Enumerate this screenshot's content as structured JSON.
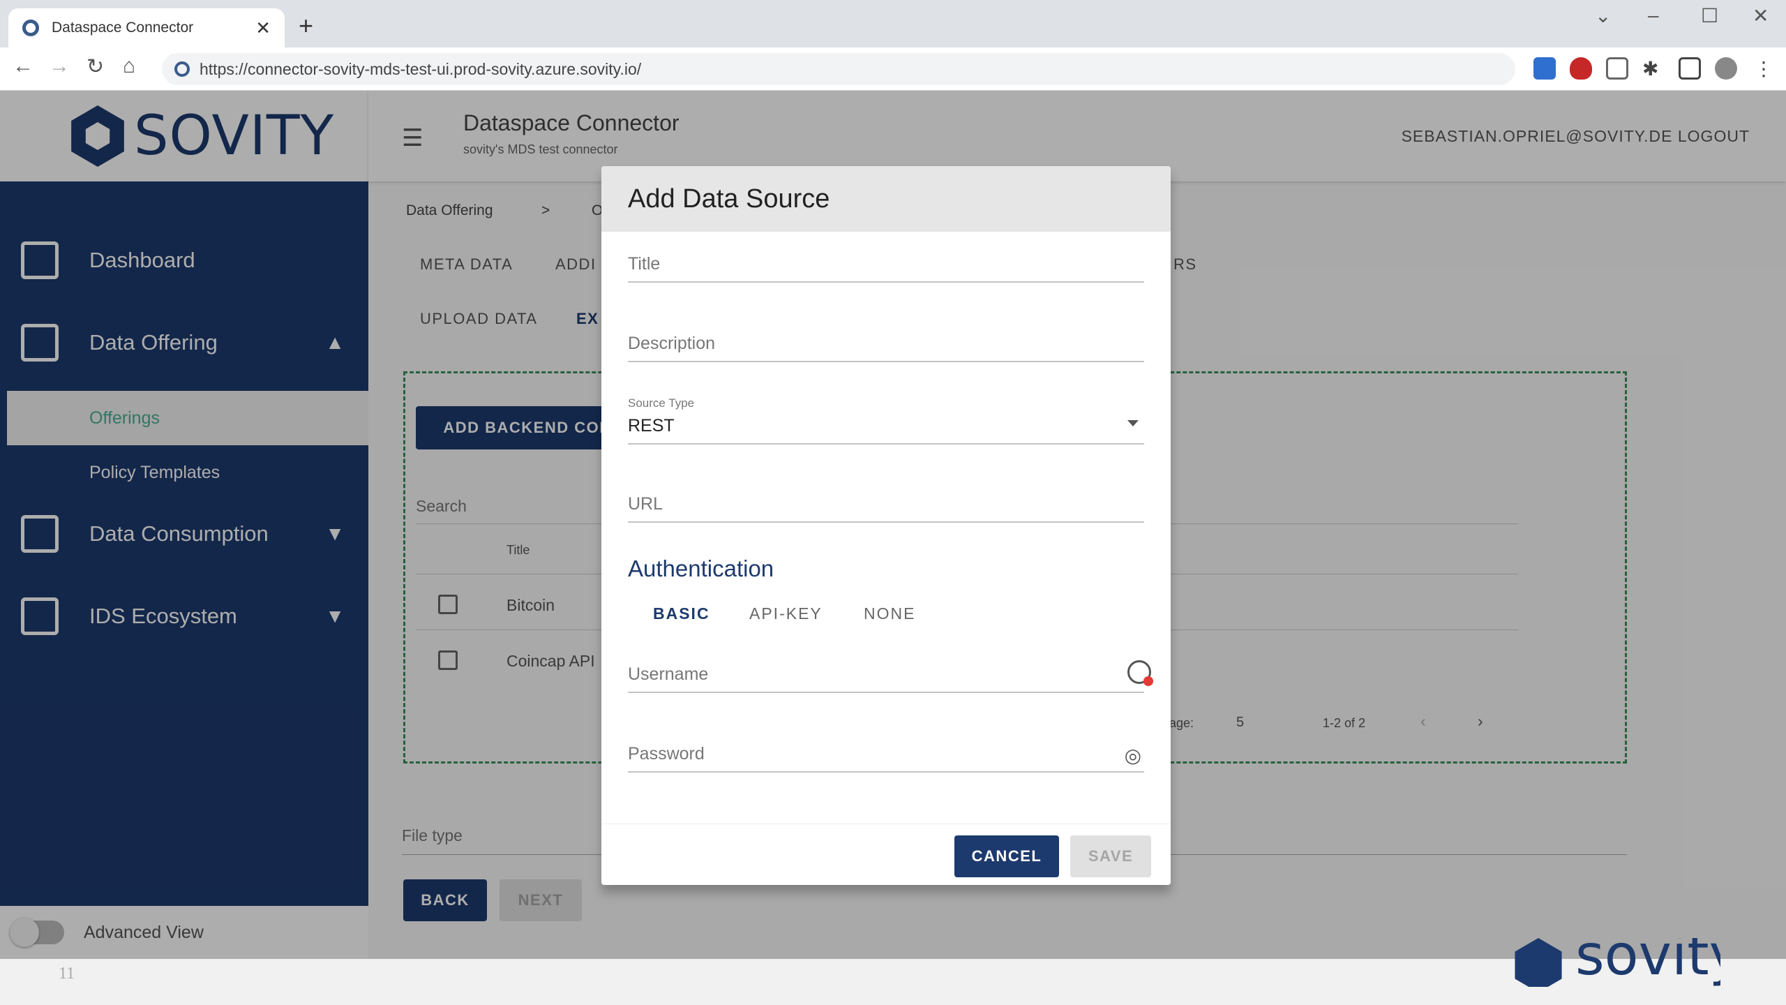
{
  "browser": {
    "tab_title": "Dataspace Connector",
    "tab_close": "✕",
    "new_tab": "+",
    "url": "https://connector-sovity-mds-test-ui.prod-sovity.azure.sovity.io/"
  },
  "app": {
    "logo_text": "SOVITY",
    "title": "Dataspace Connector",
    "subtitle": "sovity's MDS test connector",
    "user_logout": "SEBASTIAN.OPRIEL@SOVITY.DE LOGOUT"
  },
  "sidebar": {
    "items": [
      {
        "label": "Dashboard",
        "icon": "dashboard-icon"
      },
      {
        "label": "Data Offering",
        "icon": "export-icon",
        "chevron": "▲"
      },
      {
        "label": "Data Consumption",
        "icon": "document-icon",
        "chevron": "▼"
      },
      {
        "label": "IDS Ecosystem",
        "icon": "briefcase-icon",
        "chevron": "▼"
      }
    ],
    "sub_items": [
      {
        "label": "Offerings",
        "active": true
      },
      {
        "label": "Policy Templates",
        "active": false
      }
    ],
    "advanced_view": "Advanced View"
  },
  "content": {
    "breadcrumb_1": "Data Offering",
    "breadcrumb_sep": ">",
    "breadcrumb_2": "O",
    "tabs_row1": [
      "META DATA",
      "ADDI",
      "RS"
    ],
    "tabs_row2": [
      "UPLOAD DATA",
      "EX"
    ],
    "add_backend_button": "ADD BACKEND CON",
    "search_placeholder": "Search",
    "table_header_title": "Title",
    "rows": [
      "Bitcoin",
      "Coincap API"
    ],
    "paginator_label": "age:",
    "paginator_size": "5",
    "paginator_range": "1-2 of 2",
    "file_type_label": "File type",
    "back_button": "BACK",
    "next_button": "NEXT"
  },
  "dialog": {
    "title": "Add Data Source",
    "title_placeholder": "Title",
    "description_placeholder": "Description",
    "source_type_label": "Source Type",
    "source_type_value": "REST",
    "url_placeholder": "URL",
    "auth_heading": "Authentication",
    "auth_tabs": [
      "BASIC",
      "API-KEY",
      "NONE"
    ],
    "username_placeholder": "Username",
    "password_placeholder": "Password",
    "cancel_button": "CANCEL",
    "save_button": "SAVE"
  },
  "footer": {
    "page_number": "11",
    "logo_text": "sovity"
  },
  "colors": {
    "brand_navy": "#1d3a6e",
    "active_green": "#4caf92",
    "dashed_border": "#3a8f5a"
  }
}
